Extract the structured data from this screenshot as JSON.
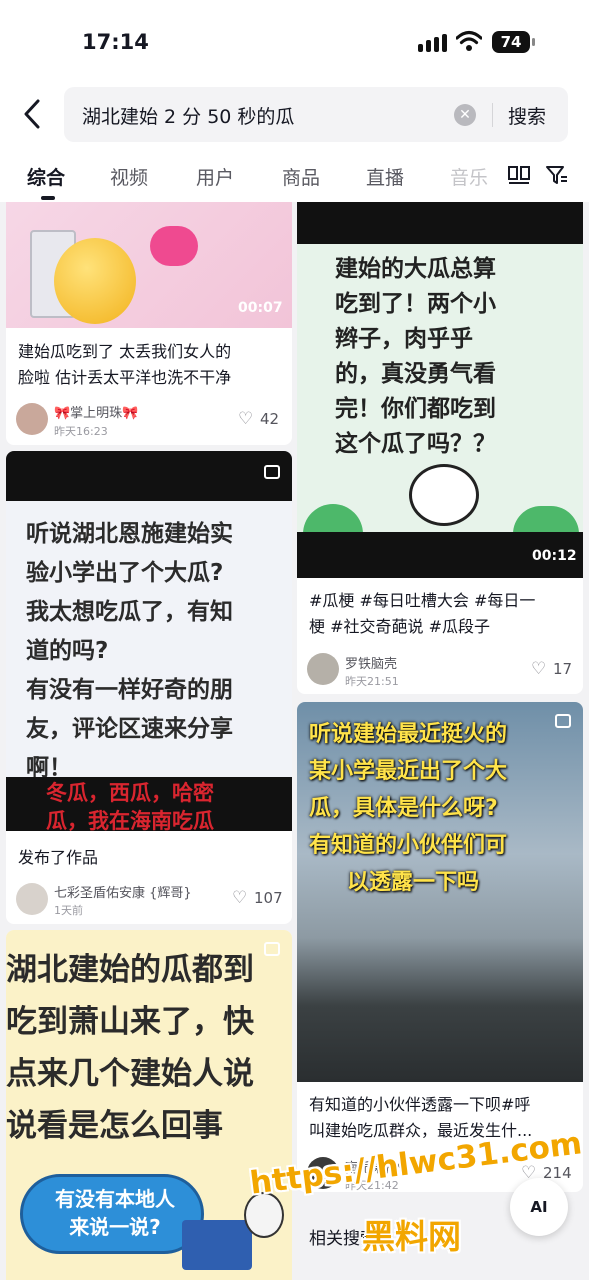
{
  "status_bar": {
    "time": "17:14",
    "battery": "74"
  },
  "search": {
    "query": "湖北建始 2 分 50 秒的瓜",
    "button_label": "搜索"
  },
  "tabs": [
    "综合",
    "视频",
    "用户",
    "商品",
    "直播",
    "音乐"
  ],
  "icons": [
    "back-chevron-icon",
    "clear-icon",
    "double-column-icon",
    "filter-icon",
    "heart-icon",
    "multi-image-icon"
  ],
  "colors": {
    "accent_pink": "#e0359a",
    "accent_blue": "#2a7fd8",
    "heart": "#8f8f96"
  },
  "cards": {
    "c1": {
      "duration": "00:07",
      "title_line1": "建始瓜吃到了   太丢我们女人的",
      "title_line2": "脸啦 估计丢太平洋也洗不干净",
      "author": "🎀掌上明珠🎀",
      "time": "昨天16:23",
      "likes": "42"
    },
    "c2": {
      "cover_lines": [
        "建始的大瓜总算",
        "吃到了！两个小",
        "辫子，肉乎乎",
        "的，真没勇气看",
        "完！你们都吃到",
        "这个瓜了吗？？"
      ],
      "duration": "00:12",
      "title_line1": "#瓜梗 #每日吐槽大会 #每日一",
      "title_line2": "梗 #社交奇葩说 #瓜段子",
      "author": "罗铁脑壳",
      "time": "昨天21:51",
      "likes": "17"
    },
    "c3": {
      "cover_lines": [
        "听说湖北恩施建始实",
        "验小学出了个大瓜?",
        "我太想吃瓜了，有知",
        "道的吗?",
        "有没有一样好奇的朋",
        "友，评论区速来分享",
        "啊！"
      ],
      "red_lines": [
        "冬瓜，西瓜，哈密",
        "瓜，我在海南吃瓜"
      ],
      "title": "发布了作品",
      "author": "七彩圣盾佑安康 {辉哥}",
      "time": "1天前",
      "likes": "107"
    },
    "c4": {
      "cover_lines": [
        "听说建始最近挺火的",
        "某小学最近出了个大",
        "瓜，具体是什么呀?",
        "有知道的小伙伴们可",
        "以透露一下吗"
      ],
      "title_line1": "有知道的小伙伴透露一下呗#呼",
      "title_line2": "叫建始吃瓜群众，最近发生什...",
      "author": "南栀果礼♥",
      "time": "昨天21:42",
      "likes": "214"
    },
    "c5": {
      "cover_lines": [
        "湖北建始的瓜都到",
        "吃到萧山来了，快",
        "点来几个建始人说",
        "说看是怎么回事"
      ],
      "bubble_lines": [
        "有没有本地人",
        "来说一说?"
      ]
    }
  },
  "related": "相关搜索",
  "watermark": {
    "url": "https://hlwc31.com",
    "site": "黑料网"
  },
  "ai_button": "AI"
}
